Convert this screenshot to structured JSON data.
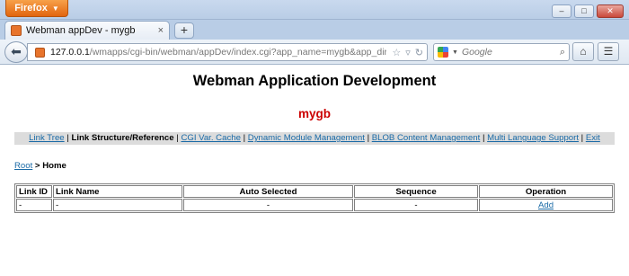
{
  "browser": {
    "app_button_label": "Firefox",
    "window_controls": {
      "minimize": "–",
      "maximize": "□",
      "close": "✕"
    },
    "tab": {
      "title": "Webman appDev - mygb",
      "close_glyph": "×"
    },
    "new_tab_glyph": "+",
    "url": {
      "host": "127.0.0.1",
      "path": "/wmapps/cgi-bin/webman/appDev/index.cgi?app_name=mygb&app_dir=E:/wmbas"
    },
    "search": {
      "placeholder": "Google"
    }
  },
  "page": {
    "title": "Webman Application Development",
    "app_name": "mygb",
    "menu": [
      {
        "label": "Link Tree",
        "link": true
      },
      {
        "label": "Link Structure/Reference",
        "link": false
      },
      {
        "label": "CGI Var. Cache",
        "link": true
      },
      {
        "label": "Dynamic Module Management",
        "link": true
      },
      {
        "label": "BLOB Content Management",
        "link": true
      },
      {
        "label": "Multi Language Support",
        "link": true
      },
      {
        "label": "Exit",
        "link": true
      }
    ],
    "menu_separator": "|",
    "breadcrumb": {
      "root": "Root",
      "separator": " > ",
      "current": "Home"
    },
    "table": {
      "headers": [
        "Link ID",
        "Link Name",
        "Auto Selected",
        "Sequence",
        "Operation"
      ],
      "rows": [
        {
          "link_id": "-",
          "link_name": "-",
          "auto_selected": "-",
          "sequence": "-",
          "operation": "Add"
        }
      ]
    }
  },
  "colors": {
    "app_name_red": "#cc0000",
    "link_blue": "#1a6aa6",
    "menu_bar_gray": "#dcdcdc",
    "firefox_orange": "#e2650f"
  }
}
